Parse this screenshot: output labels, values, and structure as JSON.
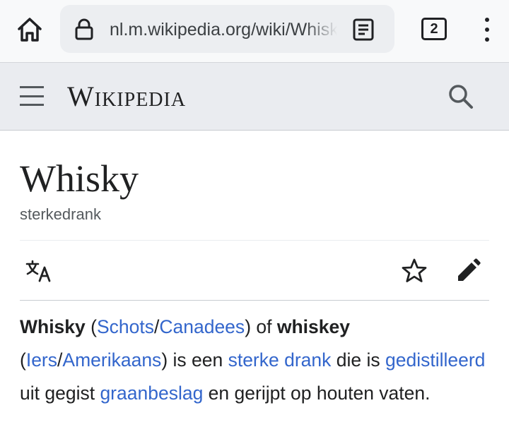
{
  "browser": {
    "url": "nl.m.wikipedia.org/wiki/Whisky",
    "tab_count": "2"
  },
  "header": {
    "wordmark": "Wikipedia"
  },
  "article": {
    "title": "Whisky",
    "subtitle": "sterkedrank",
    "intro": {
      "term1": "Whisky",
      "open1": " (",
      "link_schots": "Schots",
      "slash1": "/",
      "link_canadees": "Canadees",
      "close1": ") of ",
      "term2": "whiskey",
      "open2": " (",
      "link_iers": "Iers",
      "slash2": "/",
      "link_amerikaans": "Amerikaans",
      "text1": ") is een ",
      "link_sterke_drank": "sterke drank",
      "text2": " die is ",
      "link_gedistilleerd": "gedistilleerd",
      "text3": " uit gegist ",
      "link_graanbeslag": "graanbeslag",
      "text4": " en gerijpt op houten vaten."
    }
  },
  "colors": {
    "link": "#3366cc",
    "header_bg": "#eaecf0",
    "chrome_bg": "#f8f9fa"
  }
}
